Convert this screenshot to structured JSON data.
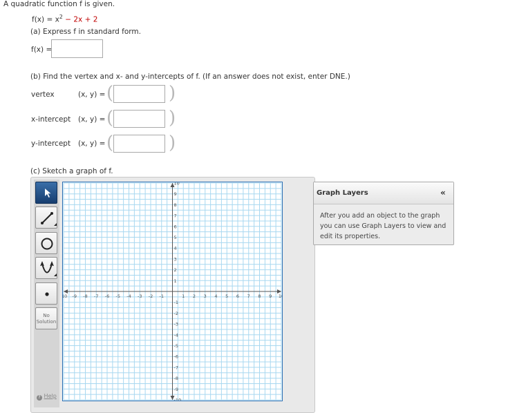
{
  "question": {
    "intro": "A quadratic function f is given.",
    "function_lhs": "f(x) = x",
    "function_exponent": "2",
    "function_rhs": "− 2x + 2"
  },
  "part_a": {
    "prompt": "(a) Express f in standard form.",
    "answer_label": "f(x) =",
    "answer_value": ""
  },
  "part_b": {
    "prompt": "(b) Find the vertex and x- and y-intercepts of f. (If an answer does not exist, enter DNE.)",
    "rows": [
      {
        "label": "vertex",
        "pair": "(x, y) =",
        "value": ""
      },
      {
        "label": "x-intercept",
        "pair": "(x, y) =",
        "value": ""
      },
      {
        "label": "y-intercept",
        "pair": "(x, y) =",
        "value": ""
      }
    ],
    "paren_open": "(",
    "paren_close": ")"
  },
  "part_c": {
    "prompt": "(c) Sketch a graph of f."
  },
  "tools": [
    {
      "name": "pointer-tool",
      "icon": "arrow-cursor-icon",
      "active": true
    },
    {
      "name": "line-tool",
      "icon": "line-segment-icon"
    },
    {
      "name": "circle-tool",
      "icon": "circle-icon"
    },
    {
      "name": "parabola-tool",
      "icon": "parabola-icon"
    },
    {
      "name": "point-tool",
      "icon": "point-icon"
    },
    {
      "name": "no-solution-tool",
      "label_line1": "No",
      "label_line2": "Solution"
    }
  ],
  "help": {
    "label": "Help",
    "icon": "help-icon"
  },
  "graph": {
    "x_range": [
      -10,
      10
    ],
    "y_range": [
      -10,
      10
    ],
    "grid_step": 0.5,
    "x_tick_labels": [
      "-10",
      "-9",
      "-8",
      "-7",
      "-6",
      "-5",
      "-4",
      "-3",
      "-2",
      "-1",
      "1",
      "2",
      "3",
      "4",
      "5",
      "6",
      "7",
      "8",
      "9",
      "10"
    ],
    "y_tick_labels": [
      "10",
      "9",
      "8",
      "7",
      "6",
      "5",
      "4",
      "3",
      "2",
      "1",
      "-1",
      "-2",
      "-3",
      "-4",
      "-5",
      "-6",
      "-7",
      "-8",
      "-9",
      "-10"
    ],
    "grid_color": "#a8d8f0",
    "border_color": "#2c6fb3"
  },
  "graph_layers": {
    "title": "Graph Layers",
    "collapse": "«",
    "description_line1": "After you add an object to the graph",
    "description_line2": "you can use Graph Layers to view and",
    "description_line3": "edit its properties."
  }
}
